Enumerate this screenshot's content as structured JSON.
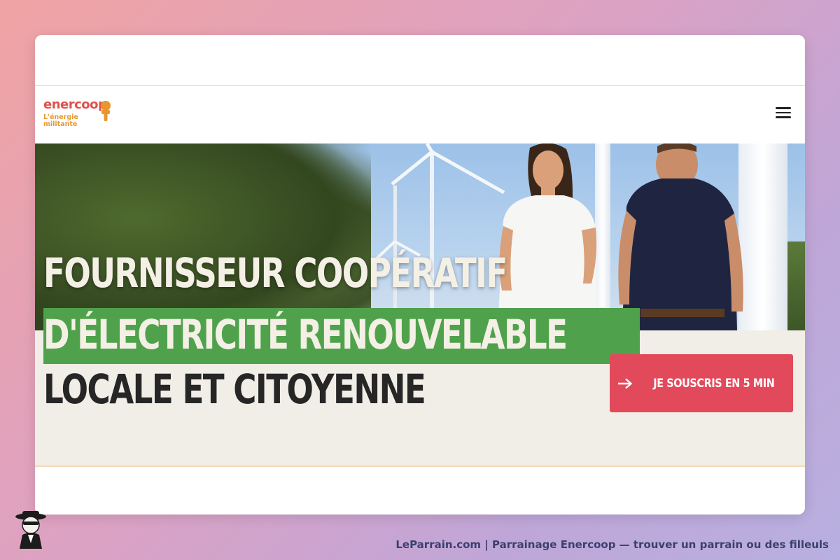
{
  "brand": {
    "name": "enercoop",
    "tagline": "L'énergie militante",
    "colors": {
      "red": "#e0524e",
      "orange": "#e8962e",
      "green": "#4fa24b",
      "cta": "#e24a5b",
      "cream": "#f1eee7"
    }
  },
  "header": {
    "menu_icon": "hamburger-menu-icon"
  },
  "hero": {
    "headline_line1": "FOURNISSEUR COOPÉRATIF",
    "headline_line2": "D'ÉLECTRICITÉ RENOUVELABLE",
    "headline_line3": "LOCALE ET CITOYENNE",
    "cta_label": "JE SOUSCRIS EN 5 MIN",
    "cta_icon": "arrow-right-icon"
  },
  "footer": {
    "credit": "LeParrain.com | Parrainage Enercoop — trouver un parrain ou des filleuls",
    "mascot_icon": "leparrain-mascot-icon"
  }
}
